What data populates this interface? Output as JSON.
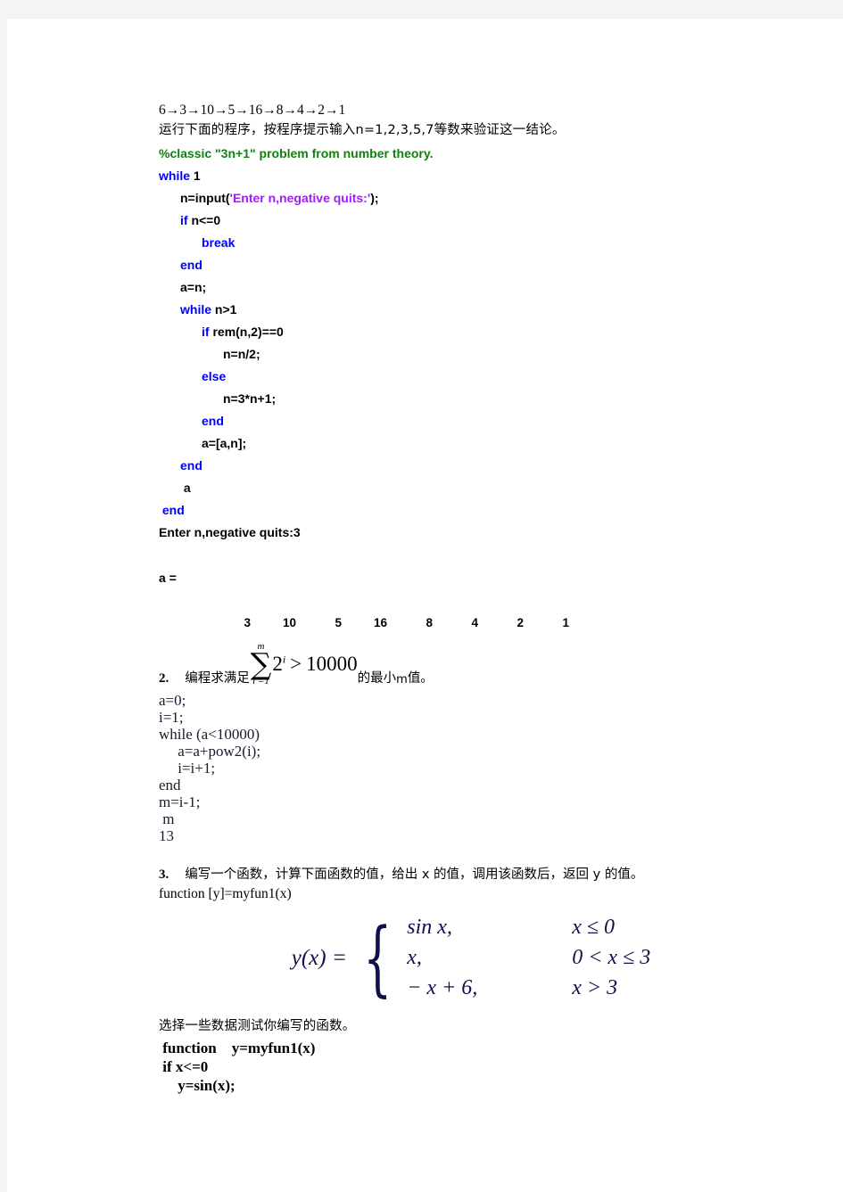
{
  "document": {
    "sequence_line": "6→3→10→5→16→8→4→2→1",
    "instruction_line": "运行下面的程序，按程序提示输入n=1,2,3,5,7等数来验证这一结论。"
  },
  "program1": {
    "lines": [
      {
        "indent": 0,
        "parts": [
          {
            "text": "%classic \"3n+1\" problem from number theory.",
            "cls": "cmt"
          }
        ]
      },
      {
        "indent": 0,
        "parts": [
          {
            "text": "while ",
            "cls": "kw"
          },
          {
            "text": "1",
            "cls": "plain"
          }
        ]
      },
      {
        "indent": 1,
        "parts": [
          {
            "text": "n=input(",
            "cls": "plain"
          },
          {
            "text": "'Enter n,negative quits:'",
            "cls": "str"
          },
          {
            "text": ");",
            "cls": "plain"
          }
        ]
      },
      {
        "indent": 1,
        "parts": [
          {
            "text": "if ",
            "cls": "kw"
          },
          {
            "text": "n<=0",
            "cls": "plain"
          }
        ]
      },
      {
        "indent": 2,
        "parts": [
          {
            "text": "break",
            "cls": "kw"
          }
        ]
      },
      {
        "indent": 1,
        "parts": [
          {
            "text": "end",
            "cls": "kw"
          }
        ]
      },
      {
        "indent": 1,
        "parts": [
          {
            "text": "a=n;",
            "cls": "plain"
          }
        ]
      },
      {
        "indent": 1,
        "parts": [
          {
            "text": "while ",
            "cls": "kw"
          },
          {
            "text": "n>1",
            "cls": "plain"
          }
        ]
      },
      {
        "indent": 2,
        "parts": [
          {
            "text": "if ",
            "cls": "kw"
          },
          {
            "text": "rem(n,2)==0",
            "cls": "plain"
          }
        ]
      },
      {
        "indent": 3,
        "parts": [
          {
            "text": "n=n/2;",
            "cls": "plain"
          }
        ]
      },
      {
        "indent": 2,
        "parts": [
          {
            "text": "else",
            "cls": "kw"
          }
        ]
      },
      {
        "indent": 3,
        "parts": [
          {
            "text": "n=3*n+1;",
            "cls": "plain"
          }
        ]
      },
      {
        "indent": 2,
        "parts": [
          {
            "text": "end",
            "cls": "kw"
          }
        ]
      },
      {
        "indent": 2,
        "parts": [
          {
            "text": "a=[a,n];",
            "cls": "plain"
          }
        ]
      },
      {
        "indent": 1,
        "parts": [
          {
            "text": "end",
            "cls": "kw"
          }
        ]
      },
      {
        "indent": 1,
        "parts": [
          {
            "text": " a",
            "cls": "plain"
          }
        ]
      },
      {
        "indent": 0,
        "parts": [
          {
            "text": " end",
            "cls": "kw"
          }
        ]
      }
    ]
  },
  "console1": {
    "prompt_line": "Enter n,negative quits:3",
    "result_label": "a =",
    "result_values": [
      "3",
      "10",
      "5",
      "16",
      "8",
      "4",
      "2",
      "1"
    ]
  },
  "problem2": {
    "number": "2.",
    "text_before": "编程求满足",
    "text_after_a": "的最小",
    "variable": "m",
    "text_after_b": "值。",
    "formula": {
      "sigma": "∑",
      "upper": "m",
      "lower": "i =1",
      "term": "2",
      "term_exp": "i",
      "relation": ">",
      "rhs": "10000"
    },
    "code": [
      "a=0;",
      "i=1;",
      "while (a<10000)",
      "     a=a+pow2(i);",
      "     i=i+1;",
      "end",
      "m=i-1;",
      " m"
    ],
    "output": "13"
  },
  "problem3": {
    "number": "3.",
    "text": "编写一个函数，计算下面函数的值，给出 x 的值，调用该函数后，返回 y 的值。",
    "signature": "function [y]=myfun1(x)",
    "piecewise": {
      "lhs": "y(x)",
      "equals": "=",
      "rows": [
        {
          "expr": "sin x,",
          "cond": "x ≤ 0"
        },
        {
          "expr": "x,",
          "cond": "0 < x ≤ 3"
        },
        {
          "expr": "− x + 6,",
          "cond": "x > 3"
        }
      ]
    },
    "test_note": "选择一些数据测试你编写的函数。",
    "code": [
      " function    y=myfun1(x)",
      " if x<=0",
      "     y=sin(x);"
    ]
  },
  "colors": {
    "keyword": "#0000ff",
    "comment": "#108010",
    "string": "#a020f0",
    "page_background": "#ffffff",
    "canvas_background": "#f4f4f4"
  }
}
